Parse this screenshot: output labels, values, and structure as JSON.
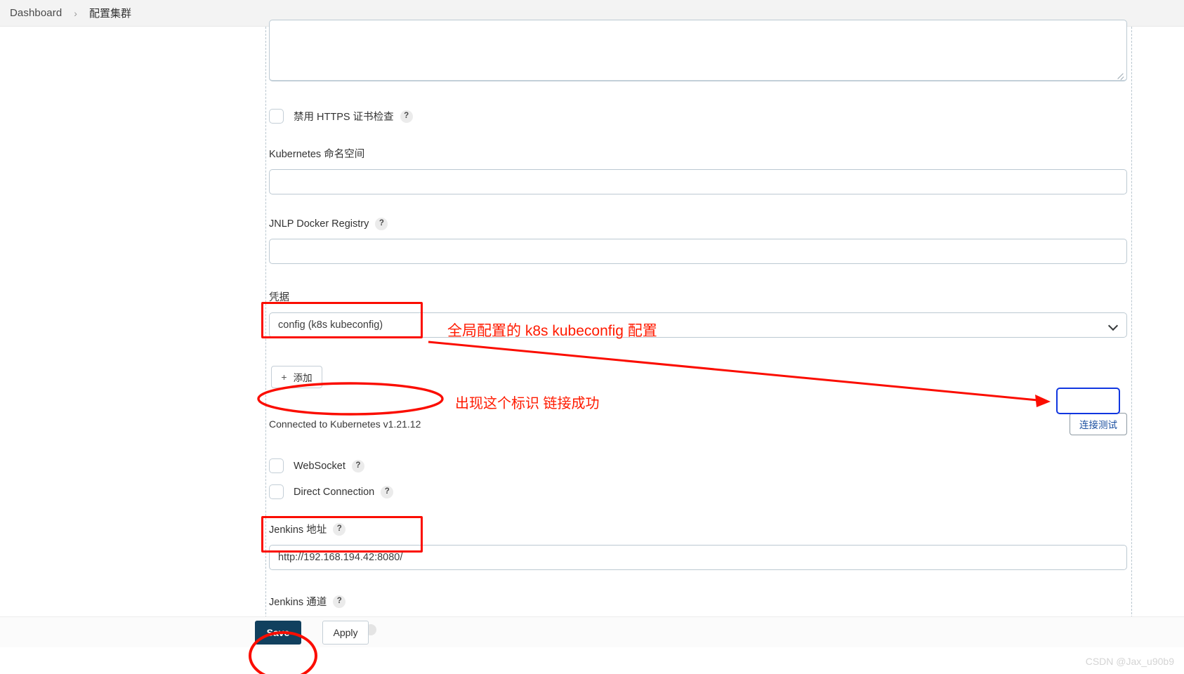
{
  "breadcrumb": {
    "root": "Dashboard",
    "separator": "›",
    "current": "配置集群"
  },
  "form": {
    "top_textarea": {
      "name": "server-certificate-textarea",
      "value": "",
      "placeholder": ""
    },
    "disable_https_check": {
      "label": "禁用 HTTPS 证书检查",
      "help": "?",
      "checked": false
    },
    "namespace": {
      "label": "Kubernetes 命名空间",
      "value": "",
      "placeholder": ""
    },
    "jnlp_registry": {
      "label": "JNLP Docker Registry",
      "help": "?",
      "value": "",
      "placeholder": ""
    },
    "credentials": {
      "label": "凭据",
      "selected": "config (k8s kubeconfig)",
      "chevron": "chevron-down-icon",
      "add_button": {
        "plus": "+",
        "label": "添加"
      }
    },
    "connection_status": "Connected to Kubernetes v1.21.12",
    "test_button": "连接测试",
    "websocket": {
      "label": "WebSocket",
      "help": "?",
      "checked": false
    },
    "direct_connection": {
      "label": "Direct Connection",
      "help": "?",
      "checked": false
    },
    "jenkins_url": {
      "label": "Jenkins 地址",
      "help": "?",
      "value": "http://192.168.194.42:8080/"
    },
    "jenkins_tunnel": {
      "label": "Jenkins 通道",
      "help": "?",
      "value": "",
      "placeholder": ""
    }
  },
  "actions": {
    "save": "Save",
    "apply": "Apply"
  },
  "annotations": {
    "credentials_note": "全局配置的 k8s kubeconfig 配置",
    "status_note": "出现这个标识 链接成功"
  },
  "watermark": "CSDN @Jax_u90b9",
  "colors": {
    "annotation_red": "#ff1a00",
    "annotation_blue": "#1036e0",
    "save_button": "#11405e",
    "test_button_text": "#1a4fa0"
  }
}
